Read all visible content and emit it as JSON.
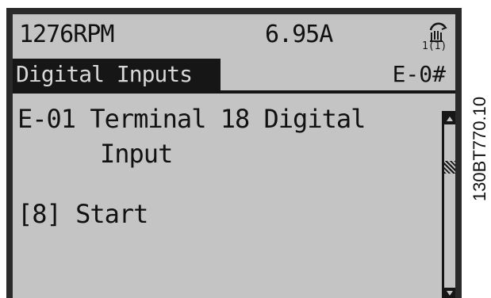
{
  "status": {
    "speed": "1276RPM",
    "current": "6.95A",
    "mode_icon": "hand-on-1-icon"
  },
  "header": {
    "menu_title": "Digital Inputs",
    "group_code": "E-0#"
  },
  "parameter": {
    "line1": "E-01 Terminal 18 Digital",
    "line2": "Input"
  },
  "value": {
    "selected_option": "[8] Start"
  },
  "figure_code": "130BT770.10",
  "colors": {
    "screen_background": "#c4c4c4",
    "ink": "#161616"
  }
}
